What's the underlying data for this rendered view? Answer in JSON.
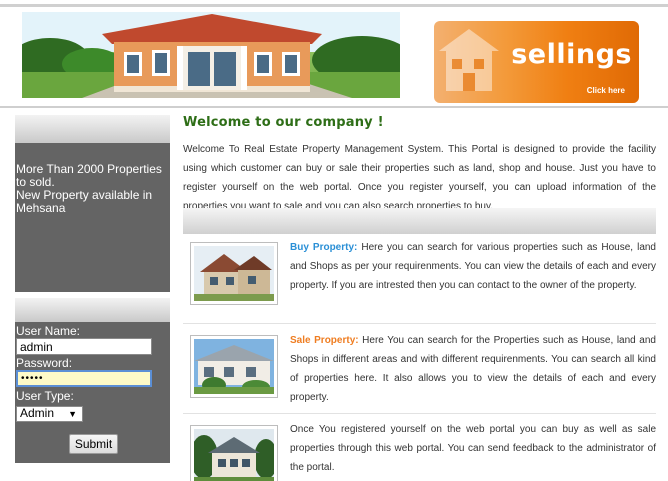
{
  "header": {
    "banner": {
      "title": "sellings",
      "cta": "Click here",
      "color": "#f07f12"
    }
  },
  "sidebar": {
    "info_lines": [
      "More Than 2000 Properties to sold.",
      "New Property available in Mehsana"
    ],
    "login": {
      "username_label": "User Name:",
      "username_value": "admin",
      "password_label": "Password:",
      "password_value": "•••••",
      "usertype_label": "User Type:",
      "usertype_selected": "Admin",
      "submit_label": "Submit"
    }
  },
  "main": {
    "welcome_title": "Welcome to our company !",
    "intro": "Welcome To Real Estate Property Management System. This Portal is designed to provide the facility using which customer can buy or sale their properties such as land, shop and house. Just you have to register yourself on the web portal. Once you register yourself, you can upload information of the properties you want to sale and you can also search properties to buy.",
    "features": [
      {
        "title": "Buy Property:",
        "text": " Here you can search for various properties such as House, land and Shops as per your requirenments. You can view the details of each and every property. If you are intrested then you can contact to the owner of the property.",
        "title_color": "#2a8fd6"
      },
      {
        "title": "Sale Property:",
        "text": " Here You can search for the Properties such as House, land and Shops in different areas and with different requirenments. You can search all kind of properties here. It also allows you to view the details of each and every property.",
        "title_color": "#ef7d21"
      },
      {
        "title": "",
        "text": "Once You registered yourself on the web portal you can buy as well as sale properties through this web portal. You can send feedback to the administrator of the portal."
      }
    ]
  }
}
